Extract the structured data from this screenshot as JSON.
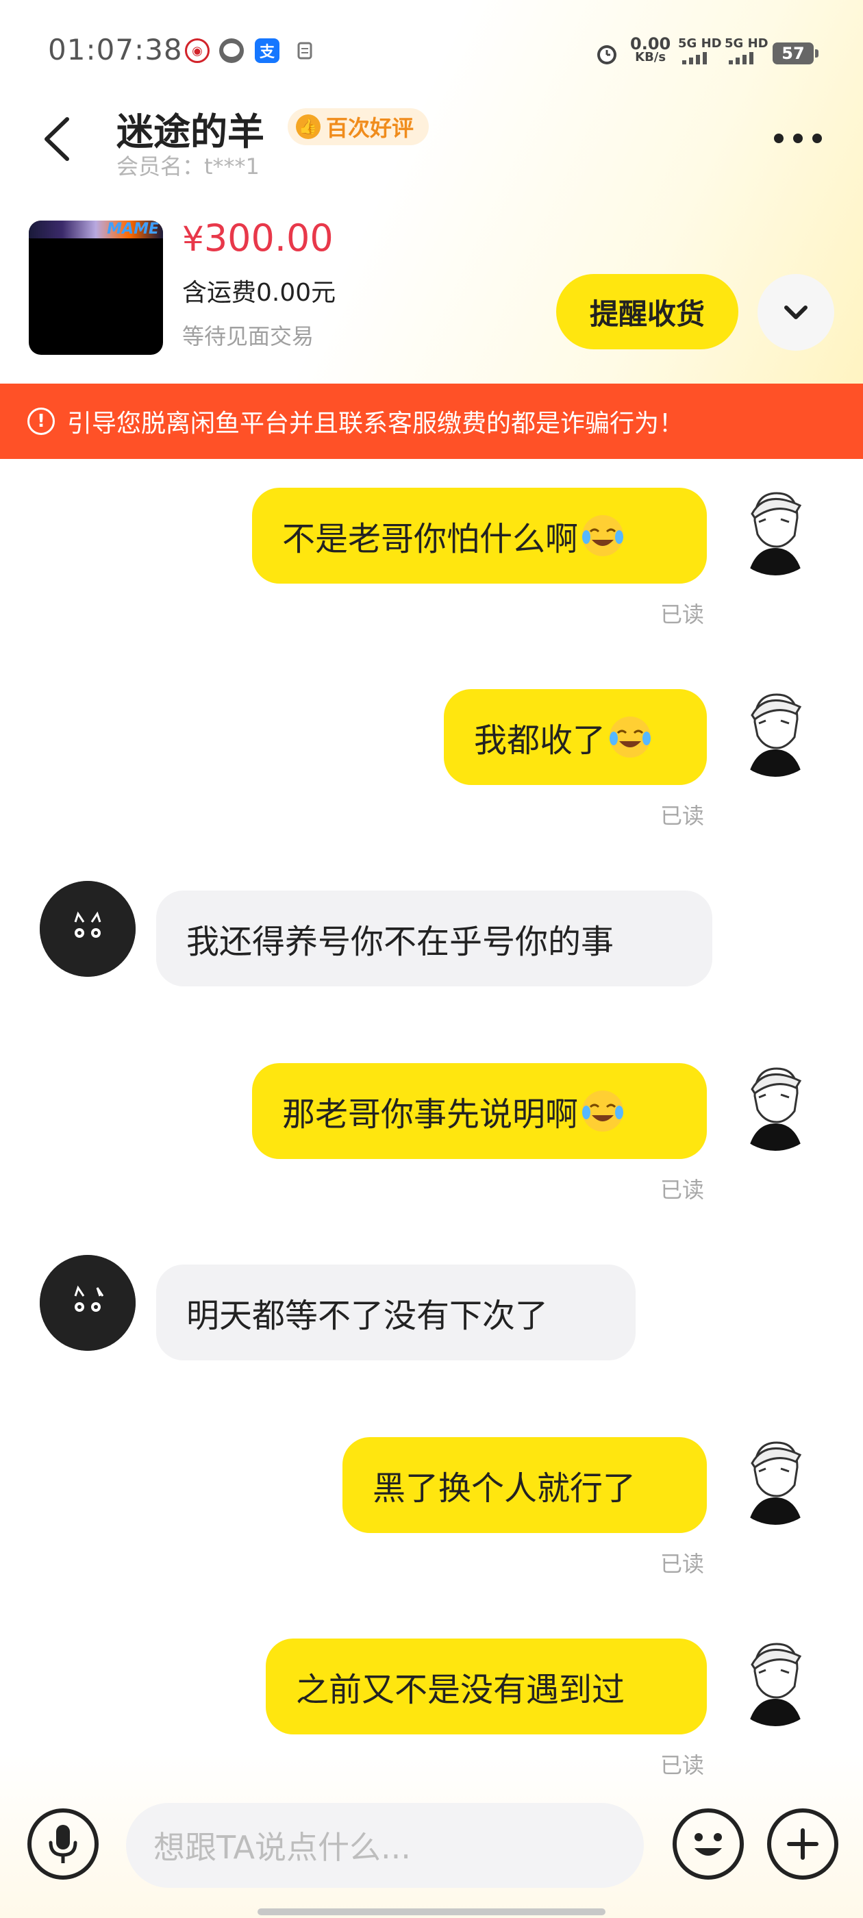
{
  "status_bar": {
    "time": "01:07:38",
    "net_speed": "0.00",
    "net_unit": "KB/s",
    "sim1": "5G HD",
    "sim2": "5G HD",
    "battery": "57"
  },
  "header": {
    "title": "迷途的羊",
    "badge": "百次好评",
    "member": "会员名：t***1"
  },
  "product": {
    "currency": "¥",
    "price": "300.00",
    "shipping": "含运费0.00元",
    "state": "等待见面交易",
    "thumb_logo": "MAME",
    "remind_button": "提醒收货"
  },
  "warning": {
    "text": "引导您脱离闲鱼平台并且联系客服缴费的都是诈骗行为！"
  },
  "messages": [
    {
      "side": "me",
      "text": "不是老哥你怕什么啊",
      "emoji": "cry-laugh",
      "read": "已读"
    },
    {
      "side": "me",
      "text": "我都收了",
      "emoji": "cry-laugh",
      "read": "已读"
    },
    {
      "side": "other",
      "text": "我还得养号你不在乎号你的事"
    },
    {
      "side": "me",
      "text": "那老哥你事先说明啊",
      "emoji": "cry-laugh",
      "read": "已读"
    },
    {
      "side": "other",
      "text": "明天都等不了没有下次了"
    },
    {
      "side": "me",
      "text": "黑了换个人就行了",
      "read": "已读"
    },
    {
      "side": "me",
      "text": "之前又不是没有遇到过",
      "read": "已读"
    }
  ],
  "input_bar": {
    "placeholder": "想跟TA说点什么..."
  },
  "colors": {
    "accent_yellow": "#ffe60f",
    "price_red": "#e8384a",
    "warning_orange": "#ff5127"
  }
}
